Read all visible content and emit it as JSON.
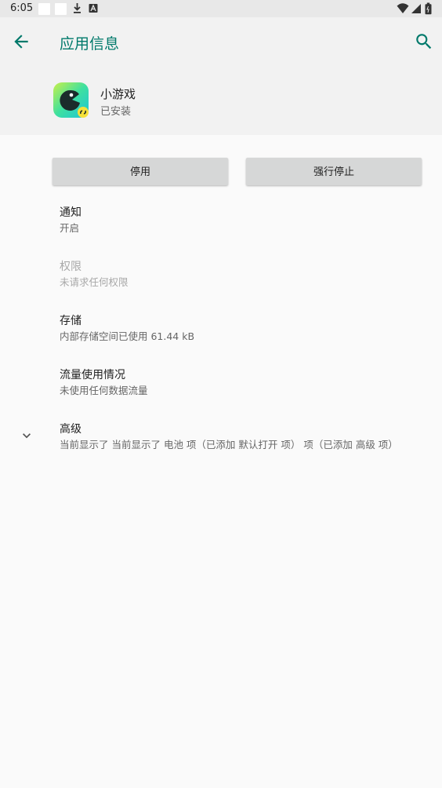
{
  "status_bar": {
    "time": "6:05",
    "icons": [
      "notification-square-icon",
      "notification-square-icon",
      "download-icon",
      "app-a-icon",
      "wifi-icon",
      "signal-icon",
      "battery-icon"
    ]
  },
  "app_bar": {
    "title": "应用信息",
    "accent_color": "#00796b",
    "icons": [
      "back-arrow-icon",
      "search-icon"
    ]
  },
  "app_header": {
    "name": "小游戏",
    "status": "已安装"
  },
  "buttons": {
    "disable": "停用",
    "force_stop": "强行停止"
  },
  "preferences": [
    {
      "title": "通知",
      "summary": "开启",
      "enabled": true
    },
    {
      "title": "权限",
      "summary": "未请求任何权限",
      "enabled": false
    },
    {
      "title": "存储",
      "summary": "内部存储空间已使用 61.44 kB",
      "enabled": true
    },
    {
      "title": "流量使用情况",
      "summary": "未使用任何数据流量",
      "enabled": true
    },
    {
      "title": "高级",
      "summary": "当前显示了 当前显示了 电池 项（已添加 默认打开 项） 项（已添加 高级 项）",
      "enabled": true,
      "icon": "chevron-down-icon"
    }
  ]
}
